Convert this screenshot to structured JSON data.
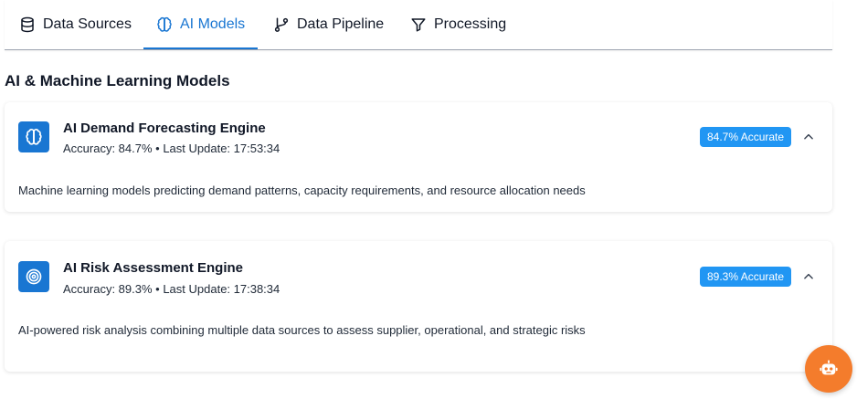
{
  "tabs": [
    {
      "label": "Data Sources",
      "icon": "database-icon",
      "active": false
    },
    {
      "label": "AI Models",
      "icon": "brain-icon",
      "active": true
    },
    {
      "label": "Data Pipeline",
      "icon": "git-branch-icon",
      "active": false
    },
    {
      "label": "Processing",
      "icon": "filter-icon",
      "active": false
    }
  ],
  "section": {
    "title": "AI & Machine Learning Models"
  },
  "models": [
    {
      "title": "AI Demand Forecasting Engine",
      "meta": "Accuracy: 84.7% • Last Update: 17:53:34",
      "badge": "84.7% Accurate",
      "description": "Machine learning models predicting demand patterns, capacity requirements, and resource allocation needs",
      "icon": "brain-icon"
    },
    {
      "title": "AI Risk Assessment Engine",
      "meta": "Accuracy: 89.3% • Last Update: 17:38:34",
      "badge": "89.3% Accurate",
      "description": "AI-powered risk analysis combining multiple data sources to assess supplier, operational, and strategic risks",
      "icon": "target-icon"
    }
  ],
  "colors": {
    "accent": "#1976d2",
    "badge": "#2196f3",
    "fab": "#f47c2c"
  },
  "fab": {
    "icon": "bot-icon"
  }
}
